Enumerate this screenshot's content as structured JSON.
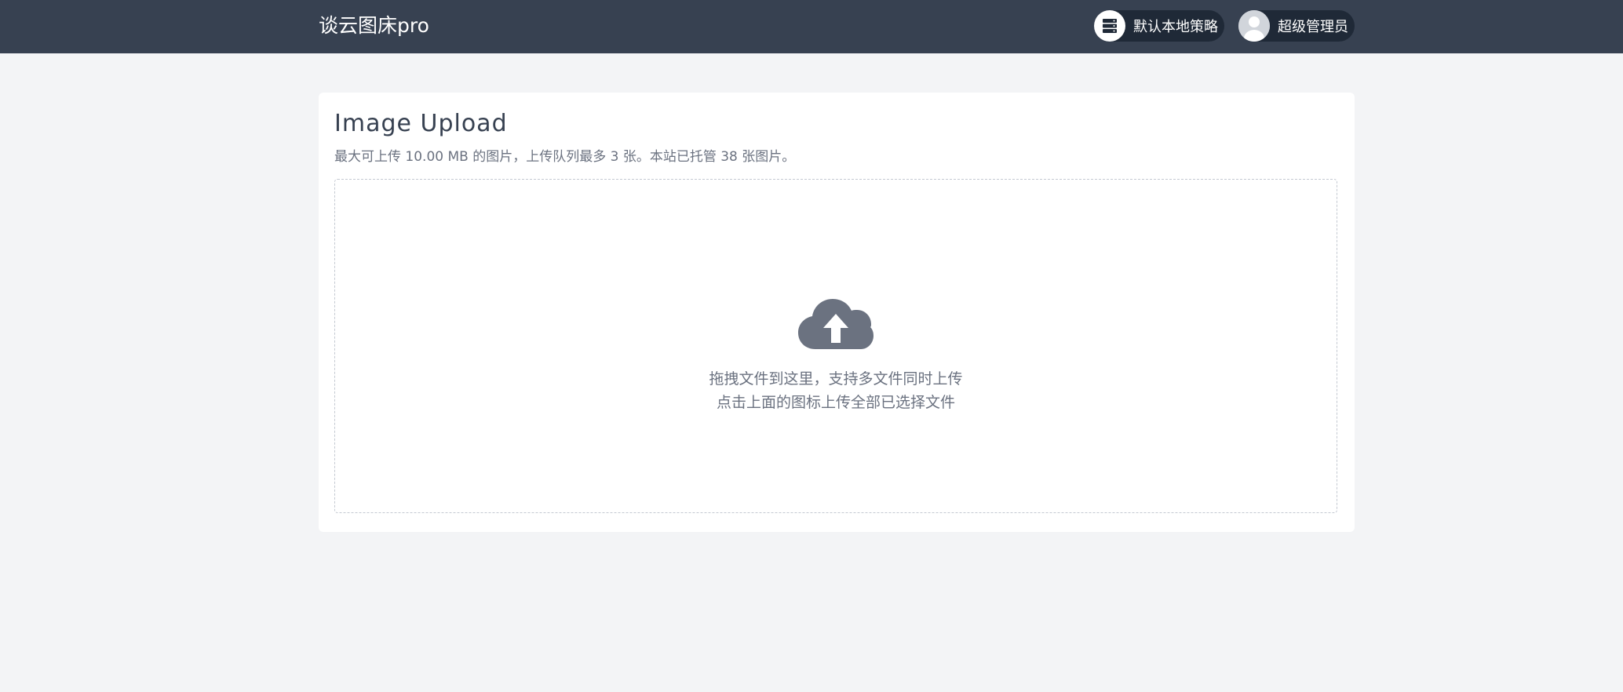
{
  "header": {
    "brand": "谈云图床pro",
    "strategy_label": "默认本地策略",
    "user_label": "超级管理员",
    "strategy_icon": "server-icon",
    "user_icon": "avatar"
  },
  "upload": {
    "title": "Image Upload",
    "subtitle": "最大可上传 10.00 MB 的图片，上传队列最多 3 张。本站已托管 38 张图片。",
    "icon": "cloud-upload-icon",
    "hint_line1": "拖拽文件到这里，支持多文件同时上传",
    "hint_line2": "点击上面的图标上传全部已选择文件"
  },
  "colors": {
    "header_bg": "#374151",
    "page_bg": "#f3f4f6",
    "card_bg": "#ffffff",
    "icon_gray": "#6b7280"
  }
}
